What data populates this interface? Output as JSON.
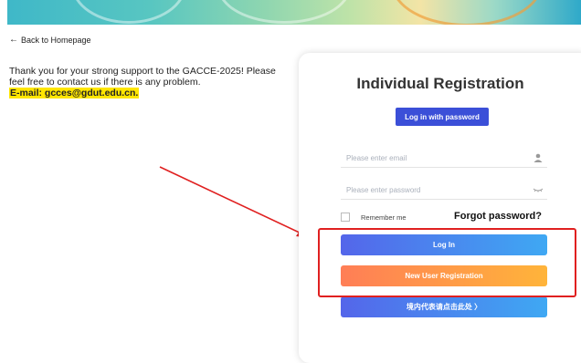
{
  "back_link": "Back to Homepage",
  "notice": {
    "text": "Thank you for your strong support to the GACCE-2025! Please feel free to contact us if there is any problem.",
    "email": "E-mail: gcces@gdut.edu.cn."
  },
  "card": {
    "title": "Individual Registration",
    "password_login_button": "Log in with password",
    "email_placeholder": "Please enter email",
    "password_placeholder": "Please enter password",
    "remember_label": "Remember me",
    "forgot_link": "Forgot password?",
    "login_button": "Log In",
    "register_button": "New User Registration",
    "representative_button": "境内代表请点击此处 〉"
  },
  "icons": {
    "back": "arrow-left-icon",
    "email_field": "user-icon",
    "password_field": "eye-closed-icon"
  },
  "colors": {
    "primary_blue": "#3b4fd8",
    "orange": "#ff9a45",
    "annotation_red": "#e02020",
    "email_highlight": "#ffe600"
  }
}
